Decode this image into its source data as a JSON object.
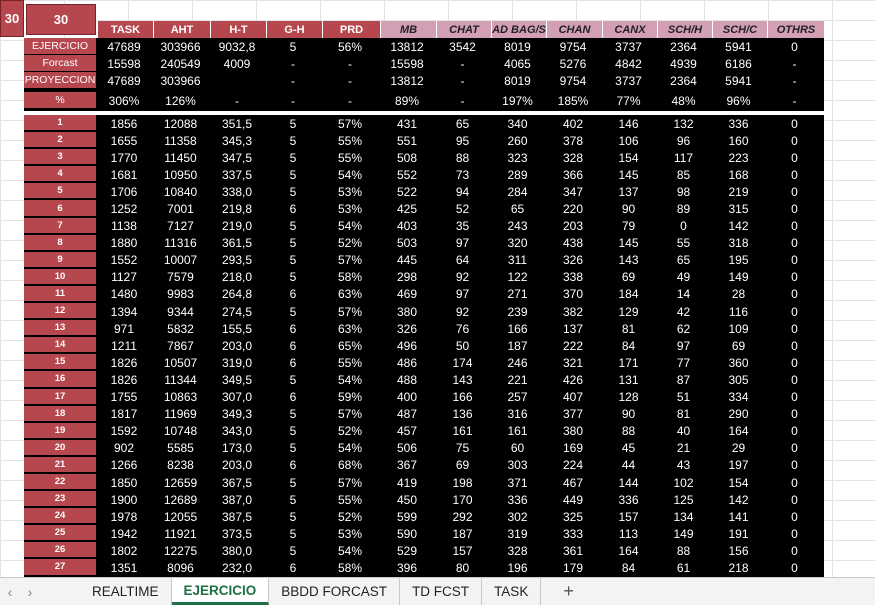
{
  "corner": {
    "a": "30",
    "b": "30"
  },
  "headers": [
    {
      "label": "TASK",
      "style": "red"
    },
    {
      "label": "AHT",
      "style": "red"
    },
    {
      "label": "H-T",
      "style": "red"
    },
    {
      "label": "G-H",
      "style": "red"
    },
    {
      "label": "PRD",
      "style": "red"
    },
    {
      "label": "MB",
      "style": "pink"
    },
    {
      "label": "CHAT",
      "style": "pink"
    },
    {
      "label": "AD BAG/S",
      "style": "pink"
    },
    {
      "label": "CHAN",
      "style": "pink"
    },
    {
      "label": "CANX",
      "style": "pink"
    },
    {
      "label": "SCH/H",
      "style": "pink"
    },
    {
      "label": "SCH/C",
      "style": "pink"
    },
    {
      "label": "OTHRS",
      "style": "pink"
    }
  ],
  "summary": [
    {
      "label": "EJERCICIO",
      "cells": [
        "47689",
        "303966",
        "9032,8",
        "5",
        "56%",
        "13812",
        "3542",
        "8019",
        "9754",
        "3737",
        "2364",
        "5941",
        "0"
      ]
    },
    {
      "label": "Forcast",
      "cells": [
        "15598",
        "240549",
        "4009",
        "-",
        "-",
        "15598",
        "-",
        "4065",
        "5276",
        "4842",
        "4939",
        "6186",
        "-"
      ]
    },
    {
      "label": "PROYECCION",
      "cells": [
        "47689",
        "303966",
        "",
        "-",
        "-",
        "13812",
        "-",
        "8019",
        "9754",
        "3737",
        "2364",
        "5941",
        "-"
      ]
    },
    {
      "label": "%",
      "cells": [
        "306%",
        "126%",
        "-",
        "-",
        "-",
        "89%",
        "-",
        "197%",
        "185%",
        "77%",
        "48%",
        "96%",
        "-"
      ]
    }
  ],
  "rows": [
    [
      "1",
      "1856",
      "12088",
      "351,5",
      "5",
      "57%",
      "431",
      "65",
      "340",
      "402",
      "146",
      "132",
      "336",
      "0"
    ],
    [
      "2",
      "1655",
      "11358",
      "345,3",
      "5",
      "55%",
      "551",
      "95",
      "260",
      "378",
      "106",
      "96",
      "160",
      "0"
    ],
    [
      "3",
      "1770",
      "11450",
      "347,5",
      "5",
      "55%",
      "508",
      "88",
      "323",
      "328",
      "154",
      "117",
      "223",
      "0"
    ],
    [
      "4",
      "1681",
      "10950",
      "337,5",
      "5",
      "54%",
      "552",
      "73",
      "289",
      "366",
      "145",
      "85",
      "168",
      "0"
    ],
    [
      "5",
      "1706",
      "10840",
      "338,0",
      "5",
      "53%",
      "522",
      "94",
      "284",
      "347",
      "137",
      "98",
      "219",
      "0"
    ],
    [
      "6",
      "1252",
      "7001",
      "219,8",
      "6",
      "53%",
      "425",
      "52",
      "65",
      "220",
      "90",
      "89",
      "315",
      "0"
    ],
    [
      "7",
      "1138",
      "7127",
      "219,0",
      "5",
      "54%",
      "403",
      "35",
      "243",
      "203",
      "79",
      "0",
      "142",
      "0"
    ],
    [
      "8",
      "1880",
      "11316",
      "361,5",
      "5",
      "52%",
      "503",
      "97",
      "320",
      "438",
      "145",
      "55",
      "318",
      "0"
    ],
    [
      "9",
      "1552",
      "10007",
      "293,5",
      "5",
      "57%",
      "445",
      "64",
      "311",
      "326",
      "143",
      "65",
      "195",
      "0"
    ],
    [
      "10",
      "1127",
      "7579",
      "218,0",
      "5",
      "58%",
      "298",
      "92",
      "122",
      "338",
      "69",
      "49",
      "149",
      "0"
    ],
    [
      "11",
      "1480",
      "9983",
      "264,8",
      "6",
      "63%",
      "469",
      "97",
      "271",
      "370",
      "184",
      "14",
      "28",
      "0"
    ],
    [
      "12",
      "1394",
      "9344",
      "274,5",
      "5",
      "57%",
      "380",
      "92",
      "239",
      "382",
      "129",
      "42",
      "116",
      "0"
    ],
    [
      "13",
      "971",
      "5832",
      "155,5",
      "6",
      "63%",
      "326",
      "76",
      "166",
      "137",
      "81",
      "62",
      "109",
      "0"
    ],
    [
      "14",
      "1211",
      "7867",
      "203,0",
      "6",
      "65%",
      "496",
      "50",
      "187",
      "222",
      "84",
      "97",
      "69",
      "0"
    ],
    [
      "15",
      "1826",
      "10507",
      "319,0",
      "6",
      "55%",
      "486",
      "174",
      "246",
      "321",
      "171",
      "77",
      "360",
      "0"
    ],
    [
      "16",
      "1826",
      "11344",
      "349,5",
      "5",
      "54%",
      "488",
      "143",
      "221",
      "426",
      "131",
      "87",
      "305",
      "0"
    ],
    [
      "17",
      "1755",
      "10863",
      "307,0",
      "6",
      "59%",
      "400",
      "166",
      "257",
      "407",
      "128",
      "51",
      "334",
      "0"
    ],
    [
      "18",
      "1817",
      "11969",
      "349,3",
      "5",
      "57%",
      "487",
      "136",
      "316",
      "377",
      "90",
      "81",
      "290",
      "0"
    ],
    [
      "19",
      "1592",
      "10748",
      "343,0",
      "5",
      "52%",
      "457",
      "161",
      "161",
      "380",
      "88",
      "40",
      "164",
      "0"
    ],
    [
      "20",
      "902",
      "5585",
      "173,0",
      "5",
      "54%",
      "506",
      "75",
      "60",
      "169",
      "45",
      "21",
      "29",
      "0"
    ],
    [
      "21",
      "1266",
      "8238",
      "203,0",
      "6",
      "68%",
      "367",
      "69",
      "303",
      "224",
      "44",
      "43",
      "197",
      "0"
    ],
    [
      "22",
      "1850",
      "12659",
      "367,5",
      "5",
      "57%",
      "419",
      "198",
      "371",
      "467",
      "144",
      "102",
      "154",
      "0"
    ],
    [
      "23",
      "1900",
      "12689",
      "387,0",
      "5",
      "55%",
      "450",
      "170",
      "336",
      "449",
      "336",
      "125",
      "142",
      "0"
    ],
    [
      "24",
      "1978",
      "12055",
      "387,5",
      "5",
      "52%",
      "599",
      "292",
      "302",
      "325",
      "157",
      "134",
      "141",
      "0"
    ],
    [
      "25",
      "1942",
      "11921",
      "373,5",
      "5",
      "53%",
      "590",
      "187",
      "319",
      "333",
      "113",
      "149",
      "191",
      "0"
    ],
    [
      "26",
      "1802",
      "12275",
      "380,0",
      "5",
      "54%",
      "529",
      "157",
      "328",
      "361",
      "164",
      "88",
      "156",
      "0"
    ],
    [
      "27",
      "1351",
      "8096",
      "232,0",
      "6",
      "58%",
      "396",
      "80",
      "196",
      "179",
      "84",
      "61",
      "218",
      "0"
    ]
  ],
  "tabs": [
    {
      "label": "REALTIME",
      "active": false
    },
    {
      "label": "EJERCICIO",
      "active": true
    },
    {
      "label": "BBDD FORCAST",
      "active": false
    },
    {
      "label": "TD FCST",
      "active": false
    },
    {
      "label": "TASK",
      "active": false
    }
  ],
  "nav": {
    "prev": "‹",
    "next": "›",
    "add": "+"
  },
  "colors": {
    "accent_red": "#b7474f",
    "accent_pink": "#d39fb5",
    "active_tab": "#1e7145"
  }
}
